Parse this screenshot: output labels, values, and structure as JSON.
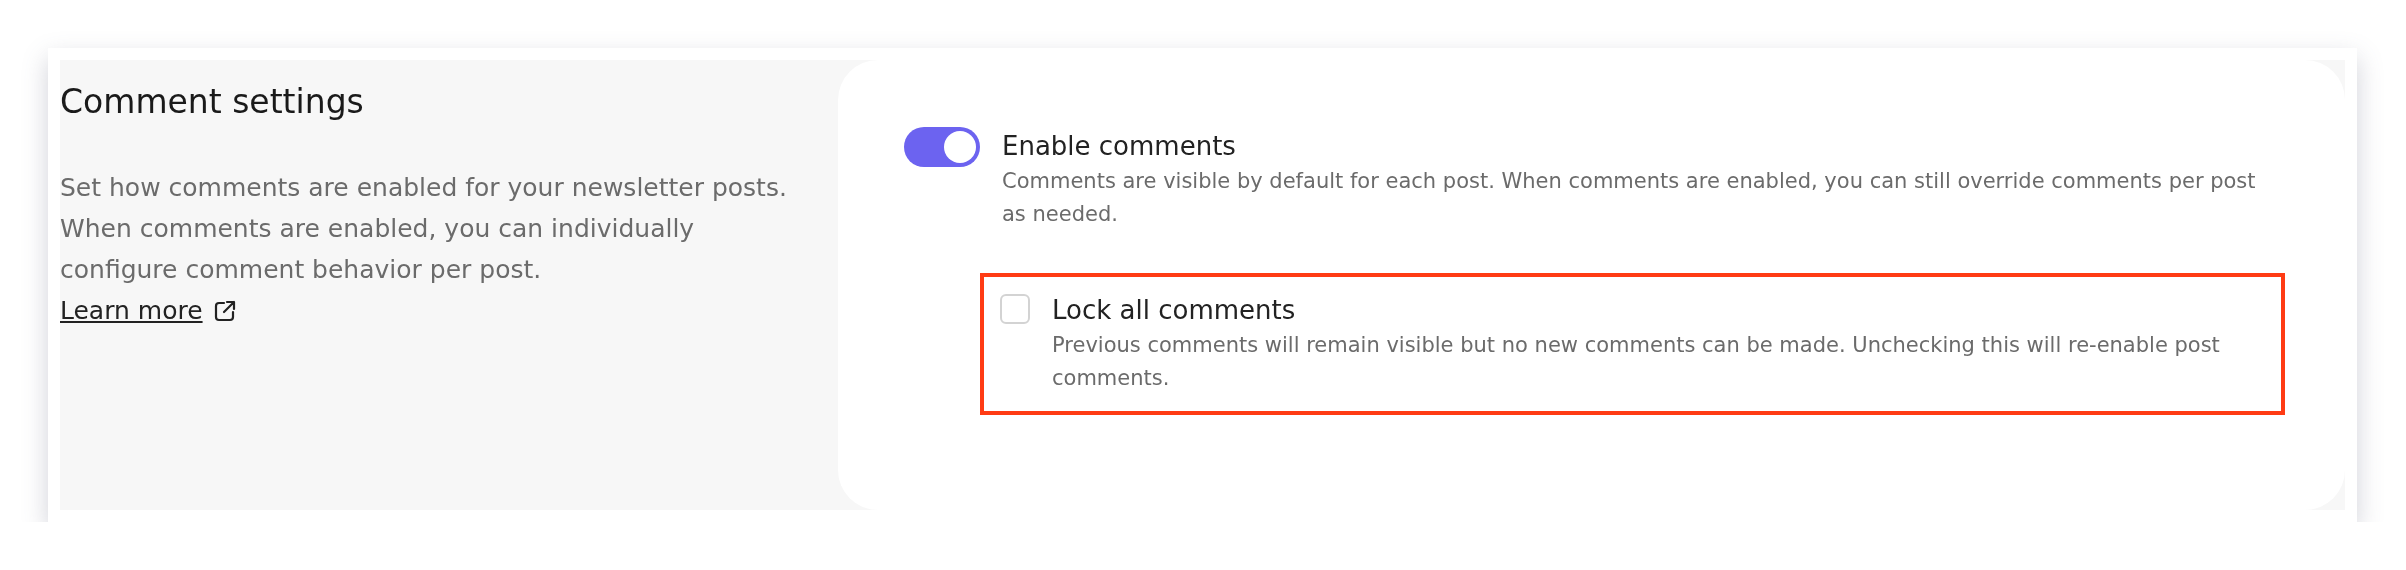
{
  "section": {
    "title": "Comment settings",
    "description": "Set how comments are enabled for your newsletter posts. When comments are enabled, you can individually configure comment behavior per post.",
    "link": "Learn more"
  },
  "options": [
    {
      "kind": "toggle",
      "label": "Enable comments",
      "description": "Comments are visible by default for each post. When comments are enabled, you can still override comments per post as needed.",
      "on": true,
      "highlighted": false,
      "children": [
        {
          "kind": "checkbox",
          "label": "Lock all comments",
          "description": "Previous comments will remain visible but no new comments can be made. Unchecking this will re-enable post comments.",
          "checked": false,
          "highlighted": true
        }
      ]
    }
  ]
}
